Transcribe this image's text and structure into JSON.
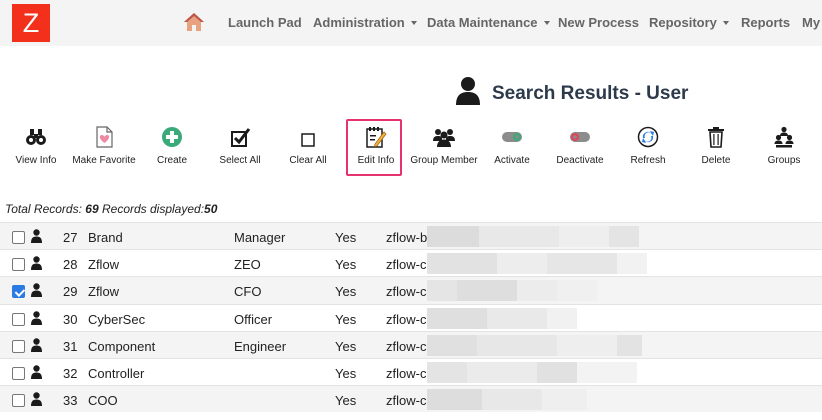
{
  "logo": {
    "letter": "Z",
    "color": "#f2301b"
  },
  "nav": {
    "home_icon": "home-icon",
    "items": [
      {
        "label": "Launch Pad",
        "has_dropdown": false
      },
      {
        "label": "Administration",
        "has_dropdown": true
      },
      {
        "label": "Data Maintenance",
        "has_dropdown": true
      },
      {
        "label": "New Process",
        "has_dropdown": false
      },
      {
        "label": "Repository",
        "has_dropdown": true
      },
      {
        "label": "Reports",
        "has_dropdown": false
      },
      {
        "label": "My",
        "has_dropdown": false
      }
    ]
  },
  "page": {
    "title": "Search Results - User",
    "title_icon": "user-icon"
  },
  "toolbar": {
    "highlighted_item": "Edit Info",
    "items": [
      {
        "label": "View Info",
        "icon": "binoculars-icon"
      },
      {
        "label": "Make Favorite",
        "icon": "favorite-icon"
      },
      {
        "label": "Create",
        "icon": "plus-circle-icon"
      },
      {
        "label": "Select All",
        "icon": "checkbox-checked-icon"
      },
      {
        "label": "Clear All",
        "icon": "checkbox-empty-icon"
      },
      {
        "label": "Edit Info",
        "icon": "edit-icon"
      },
      {
        "label": "Group Member",
        "icon": "group-member-icon"
      },
      {
        "label": "Activate",
        "icon": "toggle-on-icon"
      },
      {
        "label": "Deactivate",
        "icon": "toggle-off-icon"
      },
      {
        "label": "Refresh",
        "icon": "refresh-icon"
      },
      {
        "label": "Delete",
        "icon": "trash-icon"
      },
      {
        "label": "Groups",
        "icon": "groups-icon"
      }
    ]
  },
  "summary": {
    "total_label": "Total Records:",
    "total": "69",
    "displayed_label": "Records displayed:",
    "displayed": "50"
  },
  "rows": [
    {
      "id": "27",
      "name": "Brand",
      "role": "Manager",
      "flag": "Yes",
      "login": "zflow-b",
      "checked": false
    },
    {
      "id": "28",
      "name": "Zflow",
      "role": "ZEO",
      "flag": "Yes",
      "login": "zflow-c",
      "checked": false
    },
    {
      "id": "29",
      "name": "Zflow",
      "role": "CFO",
      "flag": "Yes",
      "login": "zflow-c",
      "checked": true
    },
    {
      "id": "30",
      "name": "CyberSec",
      "role": "Officer",
      "flag": "Yes",
      "login": "zflow-c",
      "checked": false
    },
    {
      "id": "31",
      "name": "Component",
      "role": "Engineer",
      "flag": "Yes",
      "login": "zflow-c",
      "checked": false
    },
    {
      "id": "32",
      "name": "Controller",
      "role": "",
      "flag": "Yes",
      "login": "zflow-c",
      "checked": false
    },
    {
      "id": "33",
      "name": "COO",
      "role": "",
      "flag": "Yes",
      "login": "zflow-c",
      "checked": false
    }
  ],
  "colors": {
    "highlight": "#e6336e",
    "accent": "#2a7be4",
    "title": "#2d3a4b"
  }
}
